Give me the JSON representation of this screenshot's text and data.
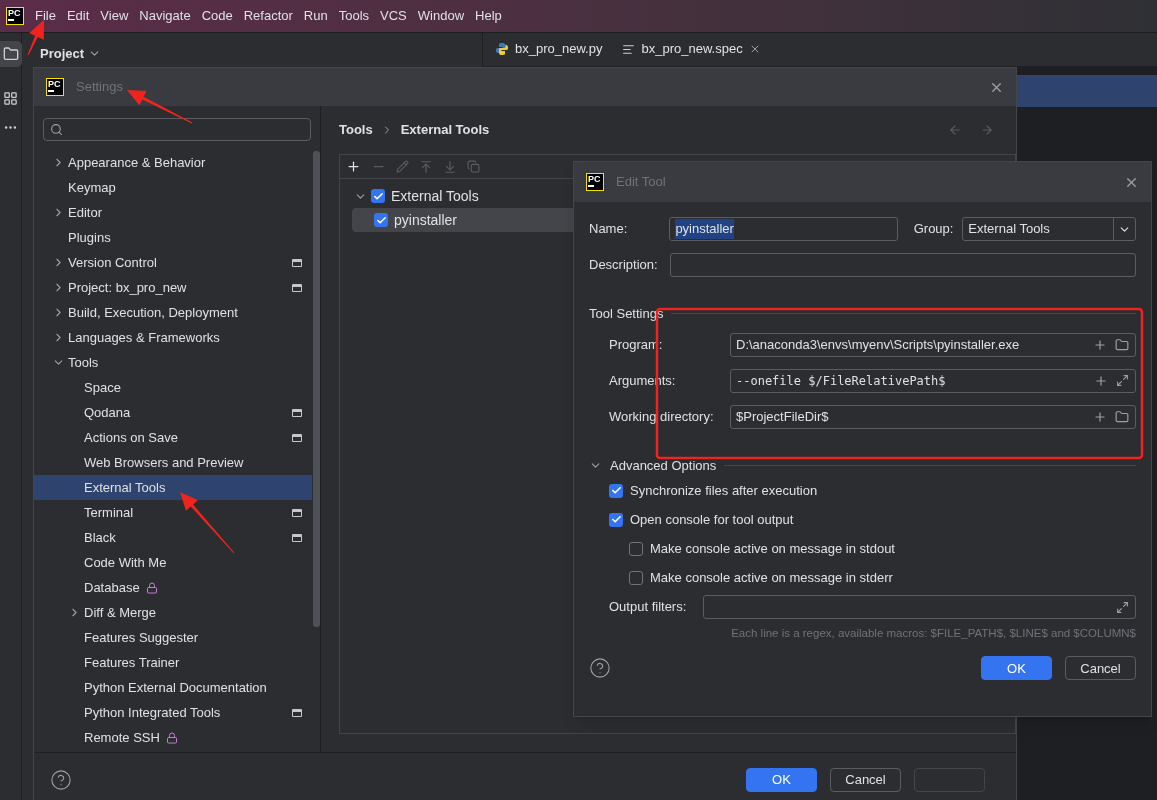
{
  "menu_bar": {
    "logo": "PC",
    "items": [
      {
        "label": "File"
      },
      {
        "label": "Edit"
      },
      {
        "label": "View"
      },
      {
        "label": "Navigate"
      },
      {
        "label": "Code"
      },
      {
        "label": "Refactor"
      },
      {
        "label": "Run"
      },
      {
        "label": "Tools"
      },
      {
        "label": "VCS"
      },
      {
        "label": "Window"
      },
      {
        "label": "Help"
      }
    ]
  },
  "project_panel": {
    "title": "Project"
  },
  "editor_tabs": [
    {
      "label": "bx_pro_new.py",
      "kind": "python",
      "closable": false
    },
    {
      "label": "bx_pro_new.spec",
      "kind": "text",
      "closable": true
    }
  ],
  "settings_dialog": {
    "logo": "PC",
    "title": "Settings",
    "breadcrumb": [
      "Tools",
      "External Tools"
    ],
    "tree": [
      {
        "label": "Appearance & Behavior",
        "kind": "plain",
        "expanded": false,
        "selected": false
      },
      {
        "label": "Keymap",
        "kind": "plain",
        "selected": false
      },
      {
        "label": "Editor",
        "kind": "plain",
        "expanded": false,
        "selected": false
      },
      {
        "label": "Plugins",
        "kind": "plain",
        "selected": false
      },
      {
        "label": "Version Control",
        "kind": "project",
        "expanded": false,
        "selected": false
      },
      {
        "label": "Project: bx_pro_new",
        "kind": "project",
        "expanded": false,
        "selected": false
      },
      {
        "label": "Build, Execution, Deployment",
        "kind": "plain",
        "expanded": false,
        "selected": false
      },
      {
        "label": "Languages & Frameworks",
        "kind": "plain",
        "expanded": false,
        "selected": false
      },
      {
        "label": "Tools",
        "kind": "plain",
        "expanded": true,
        "selected": false,
        "children": [
          {
            "label": "Space",
            "kind": "plain",
            "selected": false
          },
          {
            "label": "Qodana",
            "kind": "project",
            "selected": false
          },
          {
            "label": "Actions on Save",
            "kind": "project",
            "selected": false
          },
          {
            "label": "Web Browsers and Preview",
            "kind": "plain",
            "selected": false
          },
          {
            "label": "External Tools",
            "kind": "plain",
            "selected": true
          },
          {
            "label": "Terminal",
            "kind": "project",
            "selected": false
          },
          {
            "label": "Black",
            "kind": "project",
            "selected": false
          },
          {
            "label": "Code With Me",
            "kind": "plain",
            "selected": false
          },
          {
            "label": "Database",
            "kind": "locked",
            "selected": false
          },
          {
            "label": "Diff & Merge",
            "kind": "plain",
            "expanded": false,
            "selected": false
          },
          {
            "label": "Features Suggester",
            "kind": "plain",
            "selected": false
          },
          {
            "label": "Features Trainer",
            "kind": "plain",
            "selected": false
          },
          {
            "label": "Python External Documentation",
            "kind": "plain",
            "selected": false
          },
          {
            "label": "Python Integrated Tools",
            "kind": "project",
            "selected": false
          },
          {
            "label": "Remote SSH",
            "kind": "locked",
            "selected": false
          }
        ]
      }
    ],
    "tools_tree": [
      {
        "label": "External Tools",
        "checked": true,
        "expanded": true,
        "selected": false,
        "children": [
          {
            "label": "pyinstaller",
            "checked": true,
            "selected": true
          }
        ]
      }
    ],
    "buttons": [
      {
        "label": "OK",
        "kind": "primary"
      },
      {
        "label": "Cancel",
        "kind": "secondary"
      },
      {
        "kind": "disabled"
      }
    ]
  },
  "edit_tool_dialog": {
    "logo": "PC",
    "title": "Edit Tool",
    "name": {
      "label": "Name:",
      "value": "pyinstaller",
      "highlighted": true
    },
    "group": {
      "label": "Group:",
      "value": "External Tools"
    },
    "description": {
      "label": "Description:"
    },
    "tool_settings": {
      "title": "Tool Settings",
      "fields": [
        {
          "label": "Program:",
          "value": "D:\\anaconda3\\envs\\myenv\\Scripts\\pyinstaller.exe",
          "kind": "path"
        },
        {
          "label": "Arguments:",
          "value": "--onefile $/FileRelativePath$",
          "kind": "arguments"
        },
        {
          "label": "Working directory:",
          "value": "$ProjectFileDir$",
          "kind": "path"
        }
      ]
    },
    "advanced_options": {
      "title": "Advanced Options",
      "expanded": true,
      "options": [
        {
          "label": "Synchronize files after execution",
          "checked": true
        },
        {
          "label": "Open console for tool output",
          "checked": true,
          "children": [
            {
              "label": "Make console active on message in stdout",
              "checked": false
            },
            {
              "label": "Make console active on message in stderr",
              "checked": false
            }
          ]
        }
      ],
      "output_filters": {
        "label": "Output filters:"
      },
      "hint": "Each line is a regex, available macros: $FILE_PATH$, $LINE$ and $COLUMN$"
    },
    "buttons": [
      {
        "label": "OK",
        "kind": "primary"
      },
      {
        "label": "Cancel",
        "kind": "secondary"
      }
    ]
  }
}
